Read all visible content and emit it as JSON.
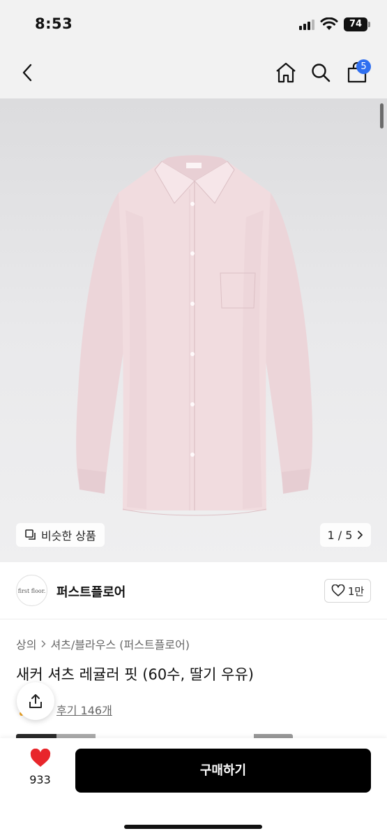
{
  "status_bar": {
    "time": "8:53",
    "battery": "74"
  },
  "nav": {
    "cart_count": "5"
  },
  "image": {
    "similar_label": "비슷한 상품",
    "pager": "1 / 5"
  },
  "brand": {
    "logo_text": "first floor.",
    "name": "퍼스트플로어",
    "likes": "1만"
  },
  "breadcrumb": {
    "category": "상의",
    "subcategory": "셔츠/블라우스 (퍼스트플로어)"
  },
  "product": {
    "title": "새커 셔츠 레귤러 핏 (60수, 딸기 우유)",
    "reviews": "후기 146개"
  },
  "bottom_bar": {
    "like_count": "933",
    "buy_label": "구매하기"
  },
  "colors": {
    "accent": "#2f6ff0",
    "heart": "#e8262b",
    "shirt": "#f1dcdf",
    "buy_button": "#000000"
  }
}
